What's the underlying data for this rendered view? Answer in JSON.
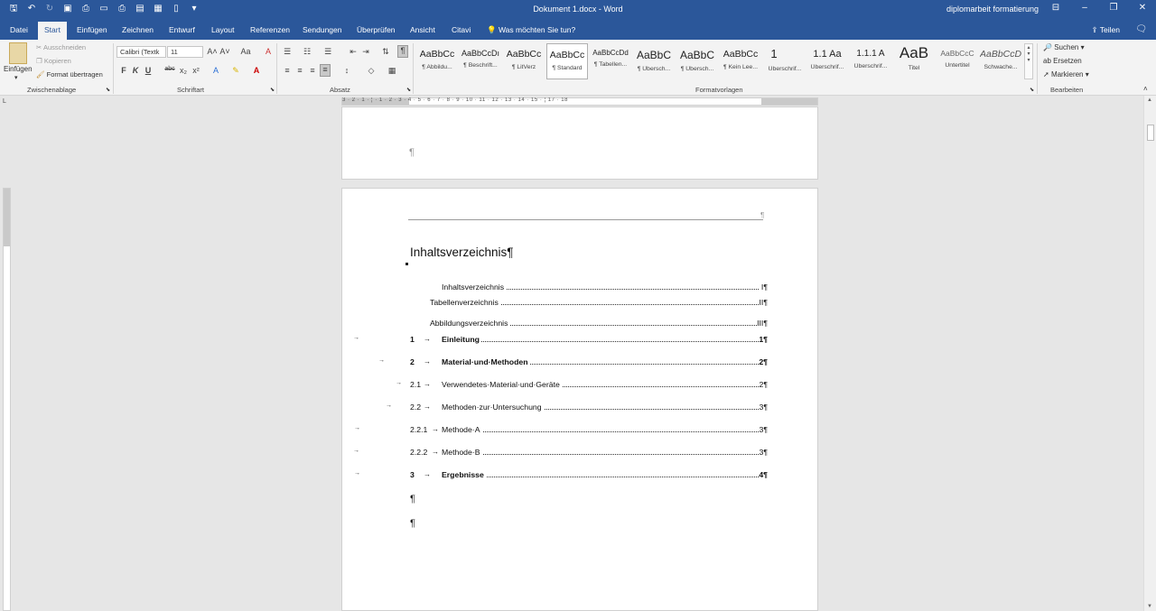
{
  "titlebar": {
    "doc_title": "Dokument 1.docx  -  Word",
    "account": "diplomarbeit formatierung"
  },
  "tabs": [
    "Datei",
    "Start",
    "Einfügen",
    "Zeichnen",
    "Entwurf",
    "Layout",
    "Referenzen",
    "Sendungen",
    "Überprüfen",
    "Ansicht",
    "Citavi"
  ],
  "active_tab": "Start",
  "tell_me": "Was möchten Sie tun?",
  "share": "Teilen",
  "ribbon": {
    "clipboard": {
      "paste": "Einfügen",
      "cut": "Ausschneiden",
      "copy": "Kopieren",
      "format_painter": "Format übertragen",
      "label": "Zwischenablage"
    },
    "font": {
      "name": "Calibri (Textk",
      "size": "11",
      "label": "Schriftart",
      "bold": "F",
      "italic": "K",
      "underline": "U",
      "strike": "abc",
      "sub": "x₂",
      "sup": "x²",
      "grow": "A˄",
      "shrink": "A˅",
      "case": "Aa",
      "clear": "A"
    },
    "paragraph": {
      "label": "Absatz"
    },
    "styles": {
      "label": "Formatvorlagen",
      "items": [
        {
          "sample": "AaBbCc",
          "name": "¶ Abbildu..."
        },
        {
          "sample": "AaBbCcDı",
          "name": "¶ Beschrift..."
        },
        {
          "sample": "AaBbCc",
          "name": "¶ LitVerz"
        },
        {
          "sample": "AaBbCc",
          "name": "¶ Standard"
        },
        {
          "sample": "AaBbCcDd",
          "name": "¶ Tabellen..."
        },
        {
          "sample": "AaBbC",
          "name": "¶ Übersch..."
        },
        {
          "sample": "AaBbC",
          "name": "¶ Übersch..."
        },
        {
          "sample": "AaBbCc",
          "name": "¶ Kein Lee..."
        },
        {
          "sample": "1",
          "name": "Überschrif..."
        },
        {
          "sample": "1.1  Aa",
          "name": "Überschrif..."
        },
        {
          "sample": "1.1.1  A",
          "name": "Überschrif..."
        },
        {
          "sample": "AaB",
          "name": "Titel"
        },
        {
          "sample": "AaBbCcC",
          "name": "Untertitel"
        },
        {
          "sample": "AaBbCcD",
          "name": "Schwache..."
        }
      ]
    },
    "editing": {
      "label": "Bearbeiten",
      "find": "Suchen",
      "replace": "Ersetzen",
      "select": "Markieren"
    }
  },
  "ruler": {
    "numbers": "3 · 2 · 1 · ¦ · 1 · 2 · 3 · 4 · 5 · 6 · 7 · 8 · 9 · 10 · 11 · 12 · 13 · 14 · 15 · ¦ 17 · 18"
  },
  "document": {
    "toc_heading": "Inhaltsverzeichnis¶",
    "entries": [
      {
        "num": "",
        "text": "Inhaltsverzeichnis",
        "page": "I¶",
        "bold": false,
        "indent": "l3"
      },
      {
        "num": "",
        "text": "Tabellenverzeichnis",
        "page": "II¶",
        "bold": false,
        "indent": "l2"
      },
      {
        "num": "",
        "text": "Abbildungsverzeichnis",
        "page": "III¶",
        "bold": false,
        "indent": "l2"
      },
      {
        "num": "1",
        "text": "Einleitung",
        "page": "1¶",
        "bold": true,
        "indent": "l1"
      },
      {
        "num": "2",
        "text": "Material·und·Methoden",
        "page": "2¶",
        "bold": true,
        "indent": "l1"
      },
      {
        "num": "2.1",
        "text": "Verwendetes·Material·und·Geräte",
        "page": "2¶",
        "bold": false,
        "indent": "l1"
      },
      {
        "num": "2.2",
        "text": "Methoden·zur·Untersuchung",
        "page": "3¶",
        "bold": false,
        "indent": "l1"
      },
      {
        "num": "2.2.1",
        "text": "Methode·A",
        "page": "3¶",
        "bold": false,
        "indent": "l1"
      },
      {
        "num": "2.2.2",
        "text": "Methode·B",
        "page": "3¶",
        "bold": false,
        "indent": "l1"
      },
      {
        "num": "3",
        "text": "Ergebnisse",
        "page": "4¶",
        "bold": true,
        "indent": "l1"
      }
    ],
    "pilcrow": "¶"
  }
}
